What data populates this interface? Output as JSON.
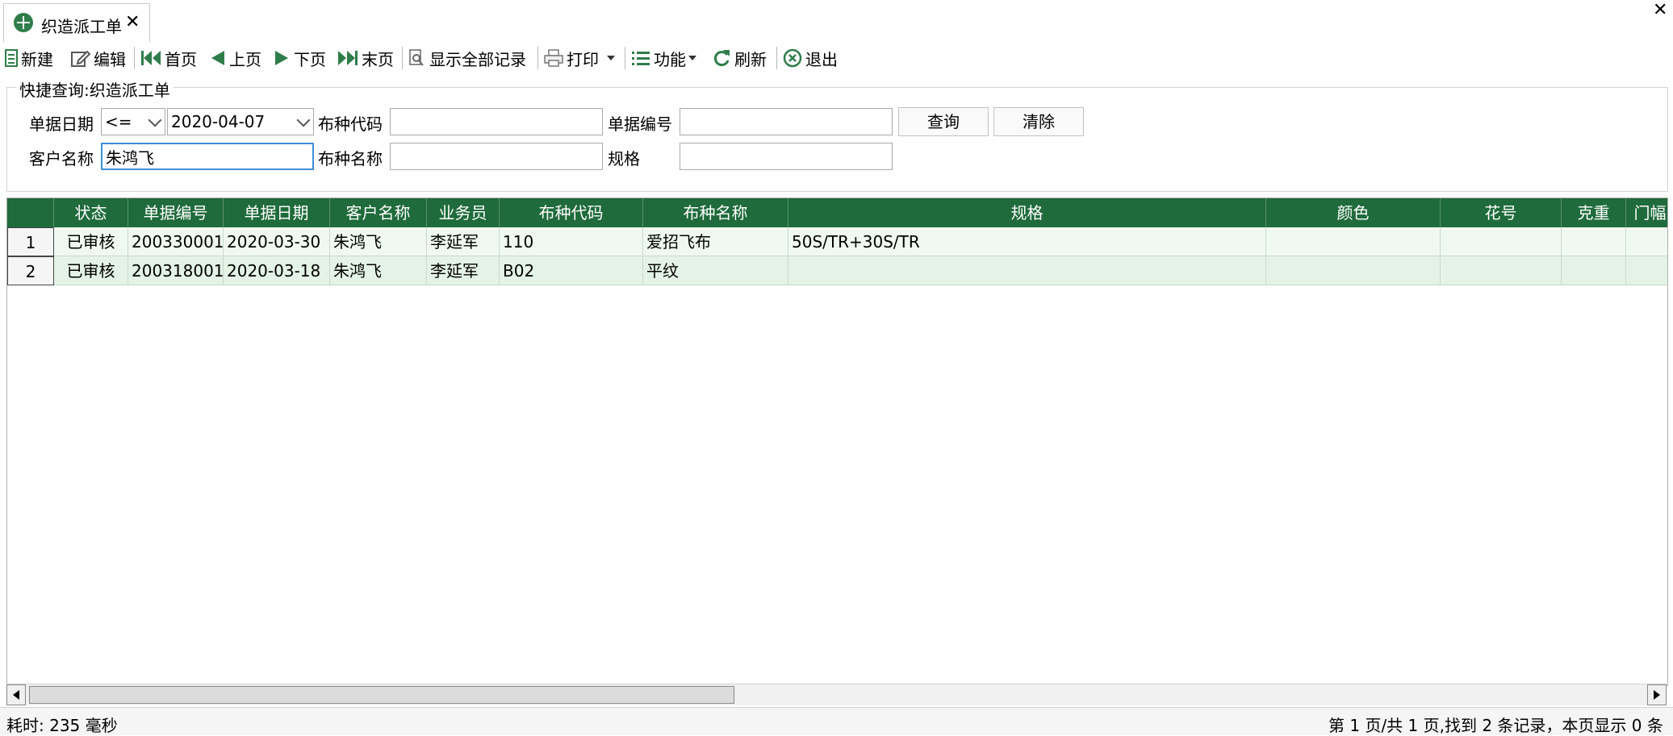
{
  "tab": {
    "title": "织造派工单",
    "close": "✕"
  },
  "window": {
    "close": "✕"
  },
  "toolbar": {
    "new": "新建",
    "edit": "编辑",
    "first": "首页",
    "prev": "上页",
    "next": "下页",
    "last": "末页",
    "show_all": "显示全部记录",
    "print": "打印",
    "function": "功能",
    "refresh": "刷新",
    "exit": "退出"
  },
  "query": {
    "title": "快捷查询:织造派工单",
    "date_label": "单据日期",
    "date_op": "<=",
    "date_value": "2020-04-07",
    "fabric_code_label": "布种代码",
    "fabric_code_value": "",
    "doc_no_label": "单据编号",
    "doc_no_value": "",
    "query_button": "查询",
    "clear_button": "清除",
    "customer_label": "客户名称",
    "customer_value": "朱鸿飞",
    "fabric_name_label": "布种名称",
    "fabric_name_value": "",
    "spec_label": "规格",
    "spec_value": ""
  },
  "grid": {
    "columns": [
      "状态",
      "单据编号",
      "单据日期",
      "客户名称",
      "业务员",
      "布种代码",
      "布种名称",
      "规格",
      "颜色",
      "花号",
      "克重",
      "门幅"
    ],
    "rows": [
      {
        "num": "1",
        "status": "已审核",
        "doc_no": "200330001",
        "date": "2020-03-30",
        "customer": "朱鸿飞",
        "salesman": "李延军",
        "fabric_code": "110",
        "fabric_name": "爱招飞布",
        "spec": "50S/TR+30S/TR",
        "color": "",
        "pattern": "",
        "weight": "",
        "width": ""
      },
      {
        "num": "2",
        "status": "已审核",
        "doc_no": "200318001",
        "date": "2020-03-18",
        "customer": "朱鸿飞",
        "salesman": "李延军",
        "fabric_code": "B02",
        "fabric_name": "平纹",
        "spec": "",
        "color": "",
        "pattern": "",
        "weight": "",
        "width": ""
      }
    ]
  },
  "status": {
    "elapsed": "耗时: 235 毫秒",
    "paging": "第 1 页/共 1 页,找到 2 条记录，本页显示 0 条"
  },
  "colors": {
    "header_bg": "#1f6b3b",
    "row_odd": "#f0f9f1",
    "row_even": "#e3f3e5",
    "accent": "#2e7d4a"
  }
}
